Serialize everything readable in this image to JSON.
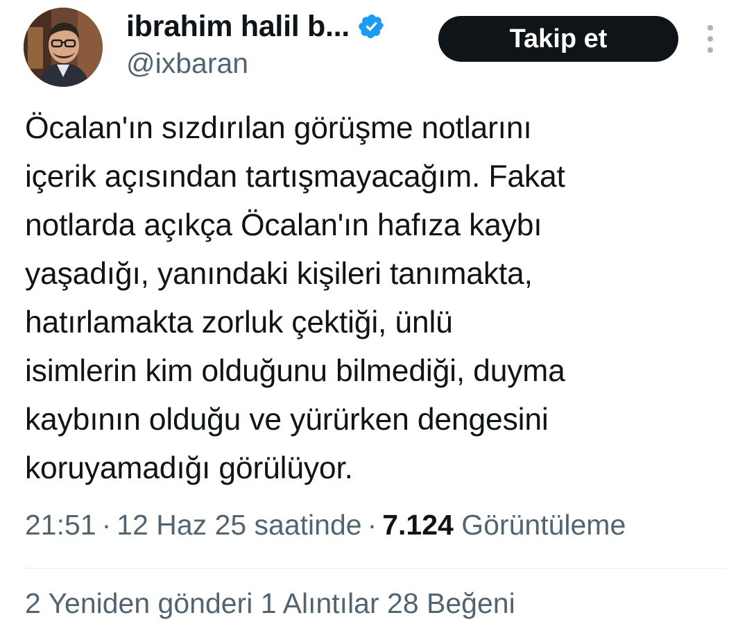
{
  "header": {
    "display_name": "ibrahim halil b...",
    "handle": "@ixbaran",
    "verified_icon": "verified-badge-icon",
    "follow_label": "Takip et",
    "more_icon": "more-vertical-icon"
  },
  "tweet": {
    "text": "Öcalan'ın sızdırılan görüşme notlarını\niçerik açısından tartışmayacağım. Fakat\nnotlarda açıkça Öcalan'ın hafıza kaybı\nyaşadığı, yanındaki kişileri tanımakta,\nhatırlamakta zorluk çektiği, ünlü\nisimlerin kim olduğunu bilmediği, duyma\nkaybının olduğu ve yürürken dengesini\nkoruyamadığı görülüyor."
  },
  "meta": {
    "time": "21:51",
    "date": "12 Haz 25 saatinde",
    "separator": "·",
    "views_count": "7.124",
    "views_label": "Görüntüleme"
  },
  "stats": {
    "partial_text": "2 Yeniden gönderi   1 Alıntılar   28 Beğeni"
  },
  "colors": {
    "text": "#0f1419",
    "secondary": "#536471",
    "verified": "#1d9bf0",
    "button_bg": "#0f1419",
    "divider": "#e7e9ea"
  }
}
